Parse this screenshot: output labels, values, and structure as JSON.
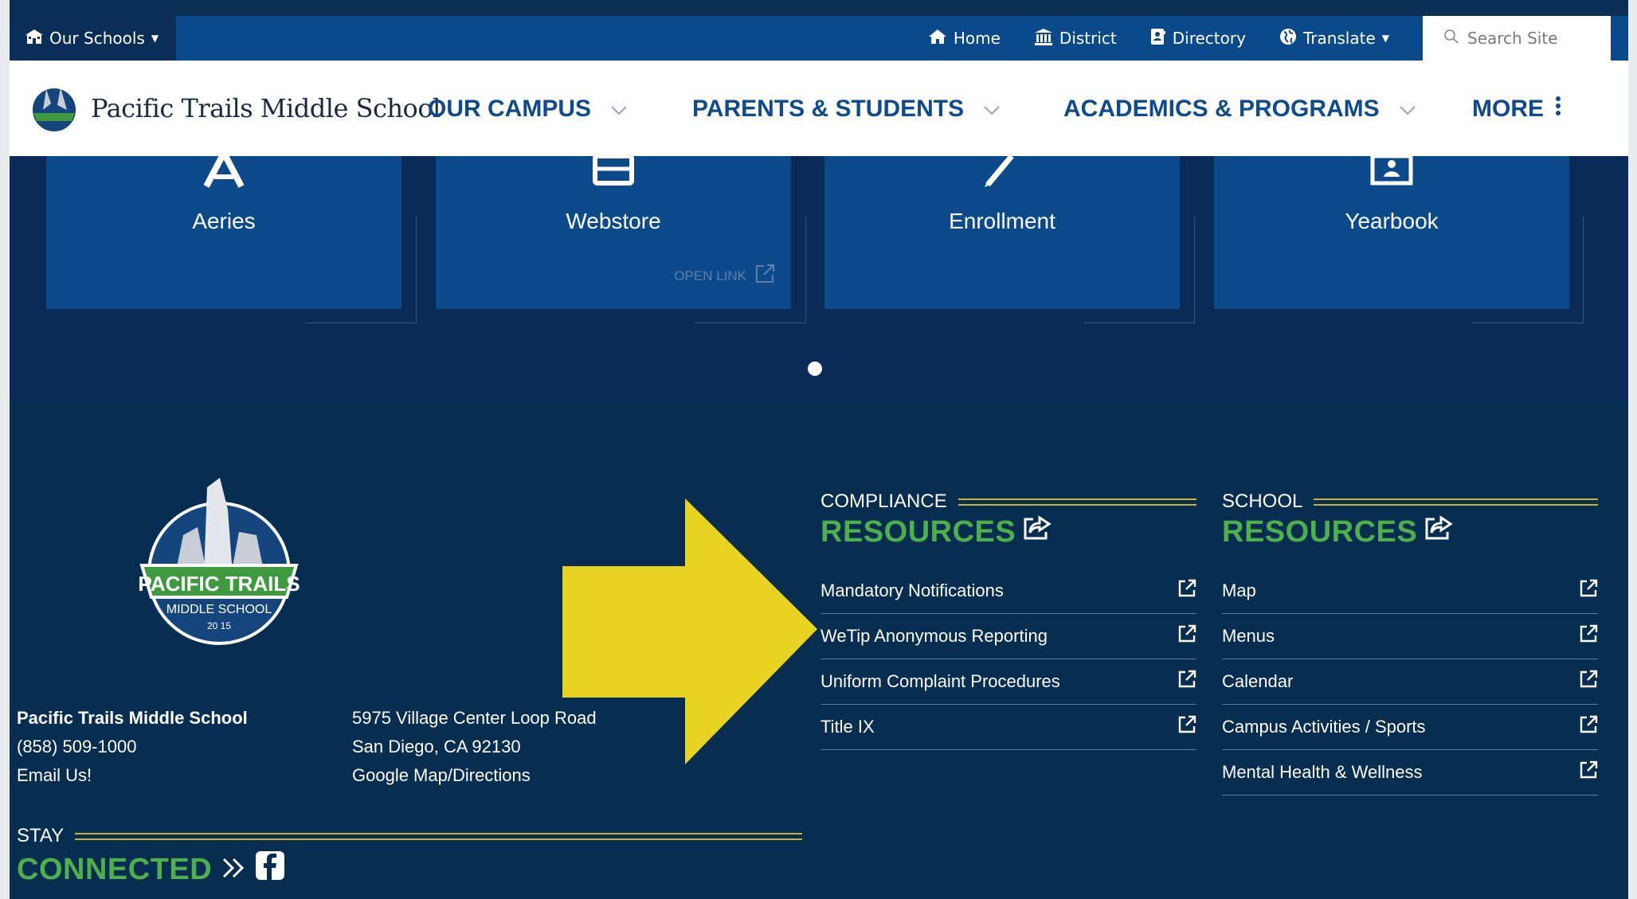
{
  "utility_bar": {
    "schools_label": "Our Schools",
    "links": [
      {
        "label": "Home",
        "icon": "home-icon"
      },
      {
        "label": "District",
        "icon": "district-building-icon"
      },
      {
        "label": "Directory",
        "icon": "directory-book-icon"
      },
      {
        "label": "Translate",
        "icon": "globe-icon"
      }
    ],
    "search_placeholder": "Search Site"
  },
  "nav": {
    "site_name": "Pacific Trails Middle School",
    "items": [
      {
        "label": "OUR CAMPUS"
      },
      {
        "label": "PARENTS & STUDENTS"
      },
      {
        "label": "ACADEMICS & PROGRAMS"
      },
      {
        "label": "MORE"
      }
    ]
  },
  "quick_links": {
    "cards": [
      {
        "label": "Aeries",
        "icon": "aeries-a-icon"
      },
      {
        "label": "Webstore",
        "icon": "webstore-basket-icon",
        "hover_text": "OPEN LINK"
      },
      {
        "label": "Enrollment",
        "icon": "pencil-icon"
      },
      {
        "label": "Yearbook",
        "icon": "yearbook-icon"
      }
    ]
  },
  "footer": {
    "logo_text_main": "PACIFIC TRAILS",
    "logo_text_sub": "MIDDLE SCHOOL",
    "logo_year": "20  15",
    "school_name": "Pacific Trails Middle School",
    "phone": "(858) 509-1000",
    "email_link": "Email Us!",
    "address_line1": "5975 Village Center Loop Road",
    "address_line2": "San Diego, CA 92130",
    "map_link": "Google Map/Directions",
    "compliance": {
      "small": "COMPLIANCE",
      "big": "RESOURCES",
      "items": [
        "Mandatory Notifications",
        "WeTip Anonymous Reporting",
        "Uniform Complaint Procedures",
        "Title IX"
      ]
    },
    "school_resources": {
      "small": "SCHOOL",
      "big": "RESOURCES",
      "items": [
        "Map",
        "Menus",
        "Calendar",
        "Campus Activities / Sports",
        "Mental Health & Wellness"
      ]
    },
    "stay": {
      "small": "STAY",
      "big": "CONNECTED"
    }
  },
  "colors": {
    "utility_bar": "#0b4a8a",
    "nav_text": "#0e4b8d",
    "card": "#0c4a8c",
    "footer": "#072d51",
    "accent_green": "#4eb04a",
    "gold_rule": "#c9b22e",
    "annotation_arrow": "#e8d323"
  }
}
